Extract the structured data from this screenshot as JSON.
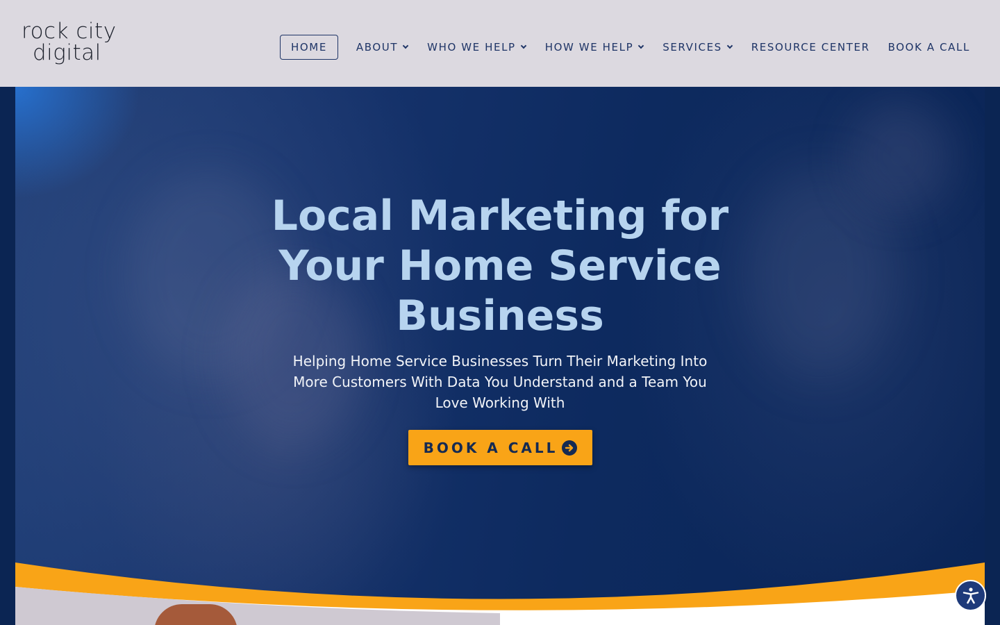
{
  "header": {
    "logo_line1": "rock city",
    "logo_line2": "digital"
  },
  "nav": {
    "items": [
      {
        "label": "HOME",
        "active": true,
        "dropdown": false
      },
      {
        "label": "ABOUT",
        "dropdown": true
      },
      {
        "label": "WHO WE HELP",
        "dropdown": true
      },
      {
        "label": "HOW WE HELP",
        "dropdown": true
      },
      {
        "label": "SERVICES",
        "dropdown": true
      },
      {
        "label": "RESOURCE CENTER",
        "dropdown": false
      },
      {
        "label": "BOOK A CALL",
        "dropdown": false
      }
    ]
  },
  "hero": {
    "title_line1": "Local Marketing for",
    "title_line2": "Your Home Service",
    "title_line3": "Business",
    "subtitle": "Helping Home Service Businesses Turn Their Marketing Into More Customers With Data You Understand and a Team You Love Working With",
    "cta_label": "BOOK A CALL",
    "cta_icon": "arrow-circle-right-icon"
  },
  "accessibility": {
    "icon": "accessibility-icon"
  },
  "colors": {
    "header_bg": "#dcd9e0",
    "nav_text": "#1e3466",
    "hero_title": "#b7d4ef",
    "accent_orange": "#f9a417",
    "hero_bg": "#0d2a5f"
  }
}
